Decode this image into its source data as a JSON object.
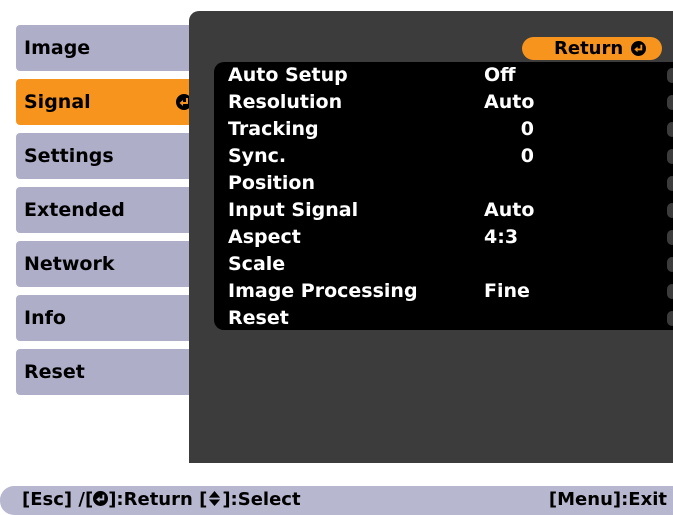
{
  "sidebar": {
    "items": [
      {
        "label": "Image"
      },
      {
        "label": "Signal"
      },
      {
        "label": "Settings"
      },
      {
        "label": "Extended"
      },
      {
        "label": "Network"
      },
      {
        "label": "Info"
      },
      {
        "label": "Reset"
      }
    ],
    "active_index": 1
  },
  "panel": {
    "return_label": "Return",
    "rows": [
      {
        "label": "Auto Setup",
        "value": "Off"
      },
      {
        "label": "Resolution",
        "value": "Auto"
      },
      {
        "label": "Tracking",
        "value": "0"
      },
      {
        "label": "Sync.",
        "value": "0"
      },
      {
        "label": "Position",
        "value": ""
      },
      {
        "label": "Input Signal",
        "value": "Auto"
      },
      {
        "label": "Aspect",
        "value": "4:3"
      },
      {
        "label": "Scale",
        "value": ""
      },
      {
        "label": "Image Processing",
        "value": "Fine"
      },
      {
        "label": "Reset",
        "value": ""
      }
    ]
  },
  "footer": {
    "esc_text": "[Esc] /[",
    "return_text": "]:Return  [",
    "select_text": "]:Select",
    "exit_text": "[Menu]:Exit"
  },
  "colors": {
    "accent": "#f7941d",
    "menu_item_bg": "#aeaec8",
    "panel_bg": "#3c3c3c",
    "row_bg": "#000000",
    "bottom_bar_bg": "#b7b7cf"
  },
  "icons": {
    "enter": "enter-icon",
    "updown": "up-down-arrow-icon"
  }
}
